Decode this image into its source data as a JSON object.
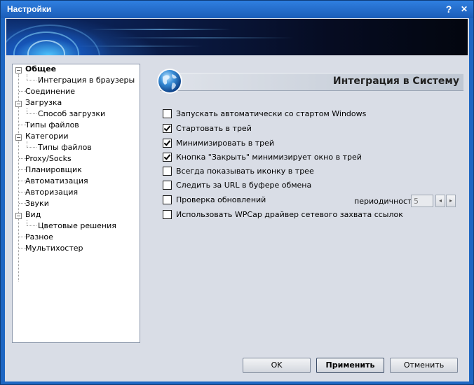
{
  "window": {
    "title": "Настройки",
    "help_label": "?",
    "close_label": "✕"
  },
  "tree": {
    "items": [
      {
        "label": "Общее"
      },
      {
        "label": "Интеграция в браузеры"
      },
      {
        "label": "Соединение"
      },
      {
        "label": "Загрузка"
      },
      {
        "label": "Способ загрузки"
      },
      {
        "label": "Типы файлов"
      },
      {
        "label": "Категории"
      },
      {
        "label": "Типы файлов"
      },
      {
        "label": "Proxy/Socks"
      },
      {
        "label": "Планировщик"
      },
      {
        "label": "Автоматизация"
      },
      {
        "label": "Авторизация"
      },
      {
        "label": "Звуки"
      },
      {
        "label": "Вид"
      },
      {
        "label": "Цветовые решения"
      },
      {
        "label": "Разное"
      },
      {
        "label": "Мультихостер"
      }
    ],
    "expand_glyph": "−"
  },
  "panel": {
    "title": "Интеграция в Систему",
    "icon": "globe-icon"
  },
  "options": [
    {
      "label": "Запускать автоматически со стартом Windows",
      "checked": false
    },
    {
      "label": "Стартовать в трей",
      "checked": true
    },
    {
      "label": "Минимизировать в трей",
      "checked": true
    },
    {
      "label": "Кнопка \"Закрыть\" минимизирует окно в трей",
      "checked": true
    },
    {
      "label": "Всегда показывать иконку в трее",
      "checked": false
    },
    {
      "label": "Следить за URL в буфере обмена",
      "checked": false
    },
    {
      "label": "Проверка обновлений",
      "checked": false
    },
    {
      "label": "Использовать WPCap драйвер сетевого захвата ссылок",
      "checked": false
    }
  ],
  "update_period": {
    "label": "периодичность",
    "value": "5",
    "dec_glyph": "◂",
    "inc_glyph": "▸"
  },
  "buttons": {
    "ok": "OK",
    "apply": "Применить",
    "cancel": "Отменить"
  },
  "colors": {
    "title_bar": "#1b5db8",
    "client_bg": "#d9dde6"
  }
}
